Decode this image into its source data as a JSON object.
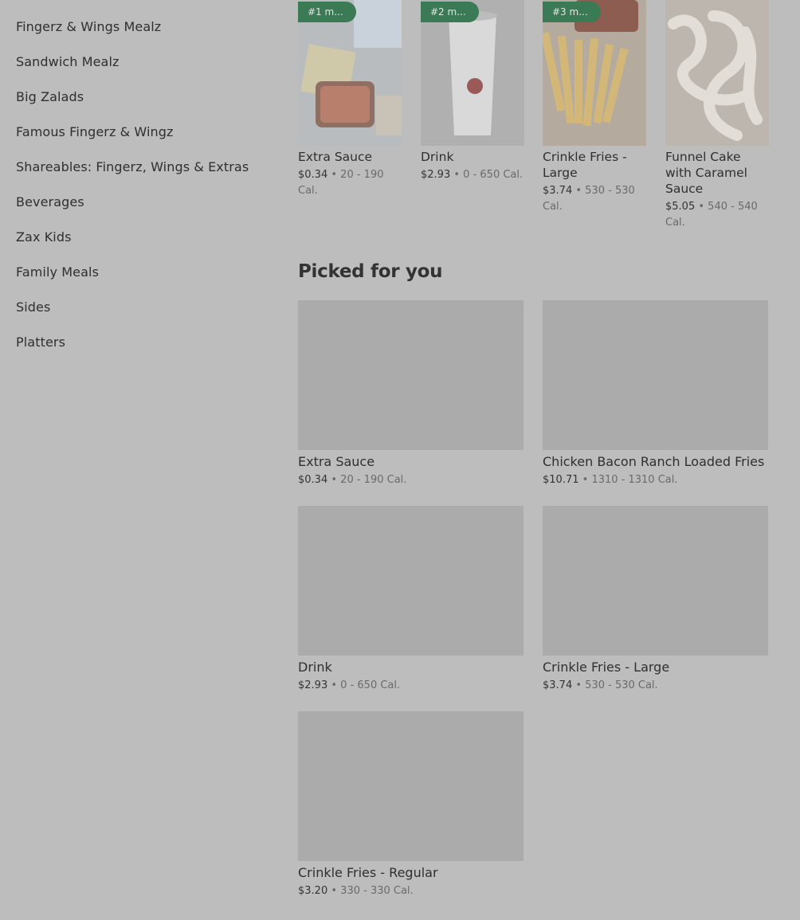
{
  "sidebar": {
    "items": [
      {
        "label": "Fingerz & Wings Mealz"
      },
      {
        "label": "Sandwich Mealz"
      },
      {
        "label": "Big Zalads"
      },
      {
        "label": "Famous Fingerz & Wingz"
      },
      {
        "label": "Shareables: Fingerz, Wings & Extras"
      },
      {
        "label": "Beverages"
      },
      {
        "label": "Zax Kids"
      },
      {
        "label": "Family Meals"
      },
      {
        "label": "Sides"
      },
      {
        "label": "Platters"
      }
    ]
  },
  "top_items": [
    {
      "badge": "#1 m...",
      "name": "Extra Sauce",
      "price": "$0.34",
      "sep": "•",
      "cal": "20 - 190 Cal."
    },
    {
      "badge": "#2 m...",
      "name": "Drink",
      "price": "$2.93",
      "sep": "•",
      "cal": "0 - 650 Cal."
    },
    {
      "badge": "#3 m...",
      "name": "Crinkle Fries - Large",
      "price": "$3.74",
      "sep": "•",
      "cal": "530 - 530 Cal."
    },
    {
      "badge": "",
      "name": "Funnel Cake with Caramel Sauce",
      "price": "$5.05",
      "sep": "•",
      "cal": "540 - 540 Cal."
    }
  ],
  "picked": {
    "title": "Picked for you",
    "items": [
      {
        "name": "Extra Sauce",
        "price": "$0.34",
        "sep": "•",
        "cal": "20 - 190 Cal."
      },
      {
        "name": "Chicken Bacon Ranch Loaded Fries",
        "price": "$10.71",
        "sep": "•",
        "cal": "1310 - 1310 Cal."
      },
      {
        "name": "Drink",
        "price": "$2.93",
        "sep": "•",
        "cal": "0 - 650 Cal."
      },
      {
        "name": "Crinkle Fries - Large",
        "price": "$3.74",
        "sep": "•",
        "cal": "530 - 530 Cal."
      },
      {
        "name": "Crinkle Fries - Regular",
        "price": "$3.20",
        "sep": "•",
        "cal": "330 - 330 Cal."
      }
    ]
  }
}
